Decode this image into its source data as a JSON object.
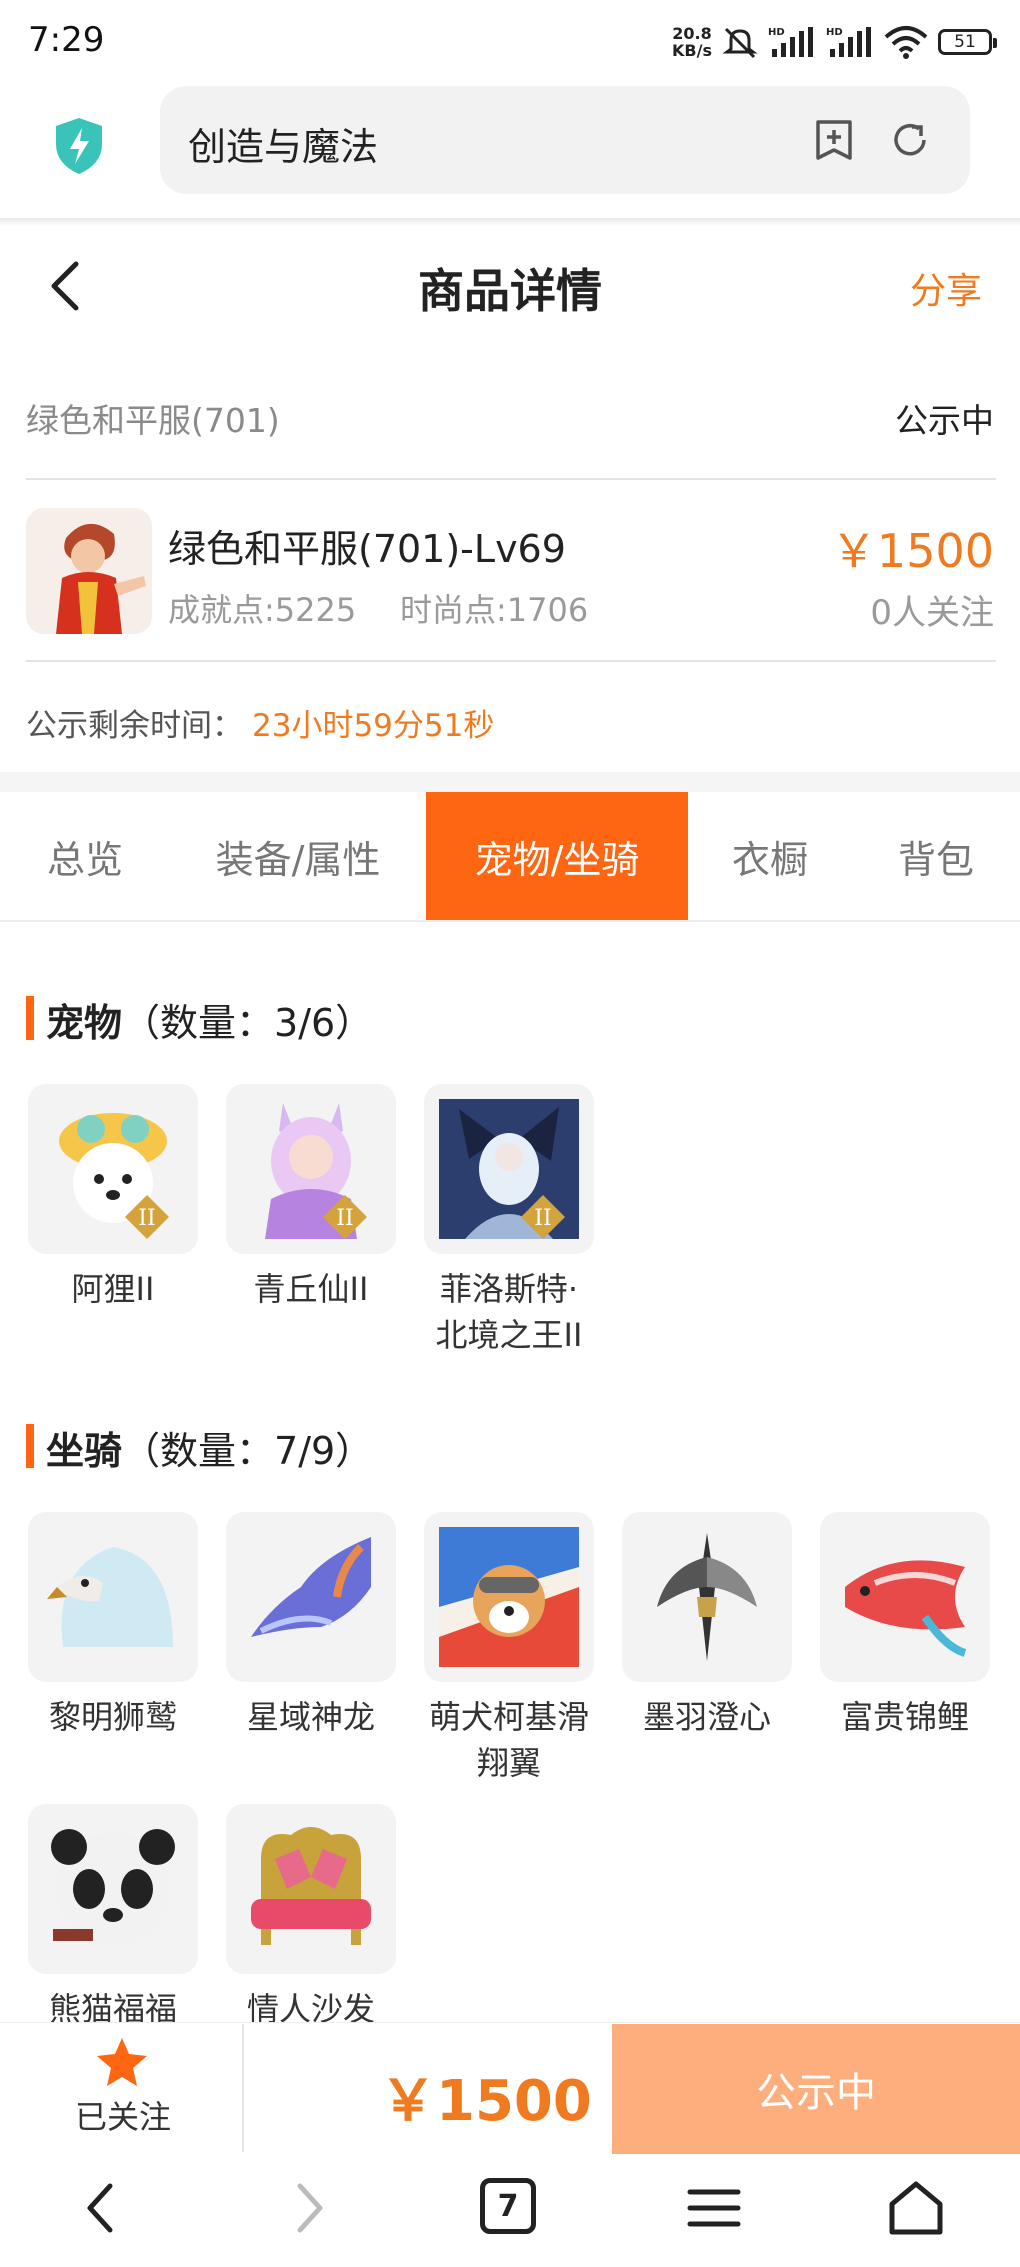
{
  "status_bar": {
    "time": "7:29",
    "net_speed_value": "20.8",
    "net_speed_unit": "KB/s",
    "battery": "51"
  },
  "browser": {
    "address_text": "创造与魔法"
  },
  "header": {
    "title": "商品详情",
    "share_label": "分享"
  },
  "product": {
    "short_name": "绿色和平服(701)",
    "status": "公示中",
    "full_name": "绿色和平服(701)-Lv69",
    "achievement_points": "成就点:5225",
    "fashion_points": "时尚点:1706",
    "price": "￥1500",
    "followers": "0人关注",
    "countdown_label": "公示剩余时间：",
    "countdown_value": "23小时59分51秒"
  },
  "tabs": [
    {
      "label": "总览"
    },
    {
      "label": "装备/属性"
    },
    {
      "label": "宠物/坐骑"
    },
    {
      "label": "衣橱"
    },
    {
      "label": "背包"
    }
  ],
  "active_tab": "宠物/坐骑",
  "pets_section": {
    "title": "宠物",
    "count": "（数量：3/6）",
    "items": [
      {
        "name": "阿狸II",
        "icon": "fox-pet-icon"
      },
      {
        "name": "青丘仙II",
        "icon": "fairy-pet-icon"
      },
      {
        "name": "菲洛斯特·北境之王II",
        "icon": "north-king-pet-icon"
      }
    ]
  },
  "mounts_section": {
    "title": "坐骑",
    "count": "（数量：7/9）",
    "items": [
      {
        "name": "黎明狮鹫",
        "icon": "griffin-mount-icon"
      },
      {
        "name": "星域神龙",
        "icon": "dragon-mount-icon"
      },
      {
        "name": "萌犬柯基滑翔翼",
        "icon": "corgi-glider-mount-icon"
      },
      {
        "name": "墨羽澄心",
        "icon": "feather-mount-icon"
      },
      {
        "name": "富贵锦鲤",
        "icon": "koi-mount-icon"
      },
      {
        "name": "熊猫福福",
        "icon": "panda-mount-icon"
      },
      {
        "name": "情人沙发",
        "icon": "sofa-mount-icon"
      }
    ]
  },
  "action_bar": {
    "follow_label": "已关注",
    "price": "￥1500",
    "status_button": "公示中"
  },
  "nav": {
    "tab_count": "7"
  },
  "colors": {
    "accent": "#ff6611",
    "price": "#f07a1f",
    "status_button": "#fdae7c"
  }
}
